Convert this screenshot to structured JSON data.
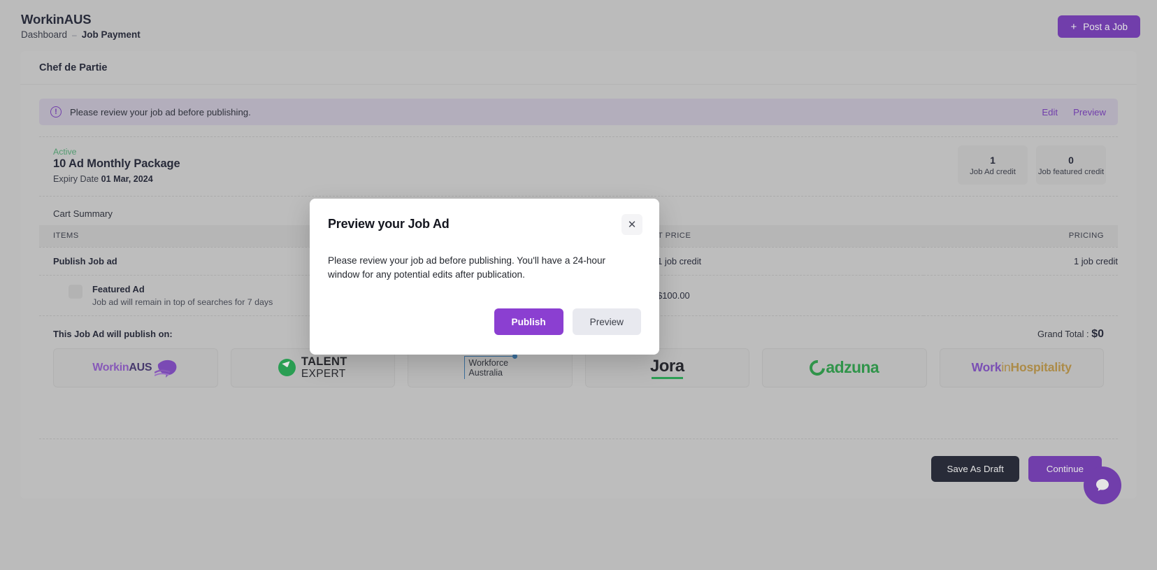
{
  "header": {
    "brand": "WorkinAUS",
    "breadcrumb": {
      "parent": "Dashboard",
      "separator": "–",
      "current": "Job Payment"
    },
    "post_job_button": {
      "plus": "+",
      "label": "Post a Job"
    }
  },
  "card": {
    "title": "Chef de Partie"
  },
  "alert": {
    "icon": "alert-circle-icon",
    "glyph": "!",
    "message": "Please review your job ad before publishing.",
    "edit_label": "Edit",
    "preview_label": "Preview"
  },
  "package": {
    "status": "Active",
    "name": "10 Ad Monthly Package",
    "expiry_label": "Expiry Date",
    "expiry_date": "01 Mar, 2024",
    "credits": [
      {
        "value": "1",
        "label": "Job Ad credit"
      },
      {
        "value": "0",
        "label": "Job featured credit"
      }
    ]
  },
  "cart": {
    "title": "Cart Summary",
    "columns": {
      "items": "ITEMS",
      "unit_price": "UNIT PRICE",
      "pricing": "PRICING"
    },
    "rows": [
      {
        "item": "Publish Job ad",
        "unit_price": "1 job credit",
        "pricing": "1 job credit",
        "has_checkbox": false,
        "subtitle": ""
      },
      {
        "item": "Featured Ad",
        "subtitle": "Job ad will remain in top of searches for 7 days",
        "unit_price": "$100.00",
        "pricing": "",
        "has_checkbox": true
      }
    ]
  },
  "publish_on": {
    "label": "This Job Ad will publish on:",
    "grand_total_label": "Grand Total :",
    "grand_total_value": "$0",
    "logos": [
      {
        "name": "workinaus-logo",
        "part1": "Workin",
        "part2": "AUS"
      },
      {
        "name": "talent-expert-logo",
        "line1": "TALENT",
        "line2": "EXPERT"
      },
      {
        "name": "workforce-australia-logo",
        "line1": "Workforce",
        "line2": "Australia"
      },
      {
        "name": "jora-logo",
        "text": "Jora"
      },
      {
        "name": "adzuna-logo",
        "text": "adzuna"
      },
      {
        "name": "workinhospitality-logo",
        "part1": "Work",
        "part2": "in",
        "part3": "Hospitality"
      }
    ]
  },
  "footer": {
    "save_draft_label": "Save As Draft",
    "continue_label": "Continue"
  },
  "chat": {
    "icon": "chat-bubble-icon"
  },
  "modal": {
    "title": "Preview your Job Ad",
    "close_glyph": "✕",
    "body": "Please review your job ad before publishing. You'll have a 24-hour window for any potential edits after publication.",
    "publish_label": "Publish",
    "preview_label": "Preview"
  },
  "colors": {
    "accent_purple": "#7030b8",
    "modal_purple": "#8b3fd1",
    "dark_navy": "#141829",
    "active_green": "#49a36d",
    "alert_bg": "#c2bccd"
  }
}
